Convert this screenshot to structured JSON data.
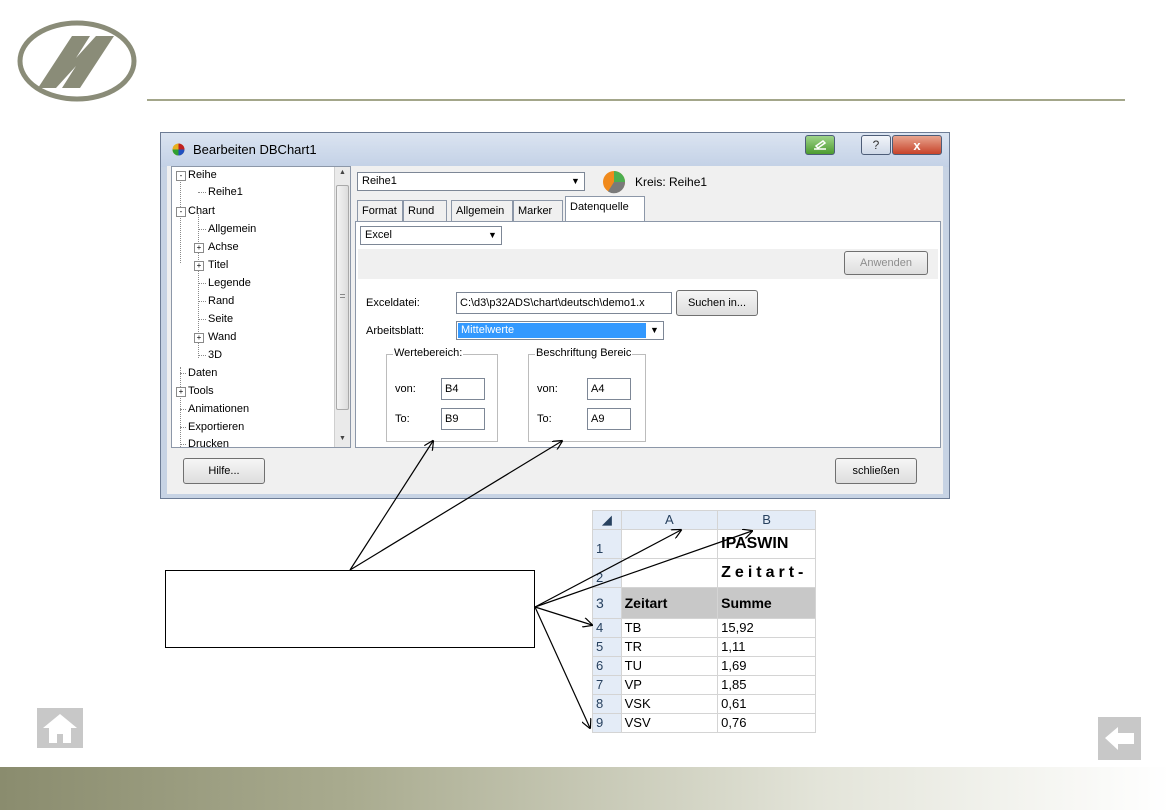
{
  "dialog": {
    "title": "Bearbeiten DBChart1",
    "help_glyph": "?",
    "close_glyph": "x"
  },
  "tree": {
    "items": [
      {
        "label": "Reihe",
        "expander": "-"
      },
      {
        "label": "Reihe1"
      },
      {
        "label": "Chart",
        "expander": "-"
      },
      {
        "label": "Allgemein"
      },
      {
        "label": "Achse",
        "expander": "+"
      },
      {
        "label": "Titel",
        "expander": "+"
      },
      {
        "label": "Legende"
      },
      {
        "label": "Rand"
      },
      {
        "label": "Seite"
      },
      {
        "label": "Wand",
        "expander": "+"
      },
      {
        "label": "3D"
      },
      {
        "label": "Daten"
      },
      {
        "label": "Tools",
        "expander": "+"
      },
      {
        "label": "Animationen"
      },
      {
        "label": "Exportieren"
      },
      {
        "label": "Drucken"
      }
    ]
  },
  "series": {
    "selected": "Reihe1",
    "info": "Kreis: Reihe1"
  },
  "tabs": [
    {
      "label": "Format"
    },
    {
      "label": "Rund"
    },
    {
      "label": "Allgemein"
    },
    {
      "label": "Marker"
    },
    {
      "label": "Datenquelle",
      "active": true
    }
  ],
  "datasource": {
    "type": "Excel",
    "apply_label": "Anwenden",
    "excel_file_label": "Exceldatei:",
    "excel_file_value": "C:\\d3\\p32ADS\\chart\\deutsch\\demo1.x",
    "browse_label": "Suchen in...",
    "sheet_label": "Arbeitsblatt:",
    "sheet_value": "Mittelwerte",
    "values_group": {
      "title": "Wertebereich:",
      "from_label": "von:",
      "from_value": "B4",
      "to_label": "To:",
      "to_value": "B9"
    },
    "labels_group": {
      "title": "Beschriftung Bereic",
      "from_label": "von:",
      "from_value": "A4",
      "to_label": "To:",
      "to_value": "A9"
    }
  },
  "buttons": {
    "help": "Hilfe...",
    "close": "schließen"
  },
  "spreadsheet": {
    "col_headers": [
      "A",
      "B"
    ],
    "rows": [
      {
        "n": "1",
        "a": "",
        "b": "IPASWIN"
      },
      {
        "n": "2",
        "a": "",
        "b": "Zeitart-"
      },
      {
        "n": "3",
        "a": "Zeitart",
        "b": "Summe"
      },
      {
        "n": "4",
        "a": "TB",
        "b": "15,92"
      },
      {
        "n": "5",
        "a": "TR",
        "b": "1,11"
      },
      {
        "n": "6",
        "a": "TU",
        "b": "1,69"
      },
      {
        "n": "7",
        "a": "VP",
        "b": "1,85"
      },
      {
        "n": "8",
        "a": "VSK",
        "b": "0,61"
      },
      {
        "n": "9",
        "a": "VSV",
        "b": "0,76"
      }
    ]
  },
  "colors": {
    "accent_line": "#a3a68a",
    "selection": "#3399ff",
    "footer_dark": "#8a8c6e"
  },
  "icons": [
    "logo-icon",
    "home-icon",
    "back-arrow-icon",
    "pie-chart-icon",
    "minimize-icon",
    "help-icon",
    "close-icon"
  ]
}
